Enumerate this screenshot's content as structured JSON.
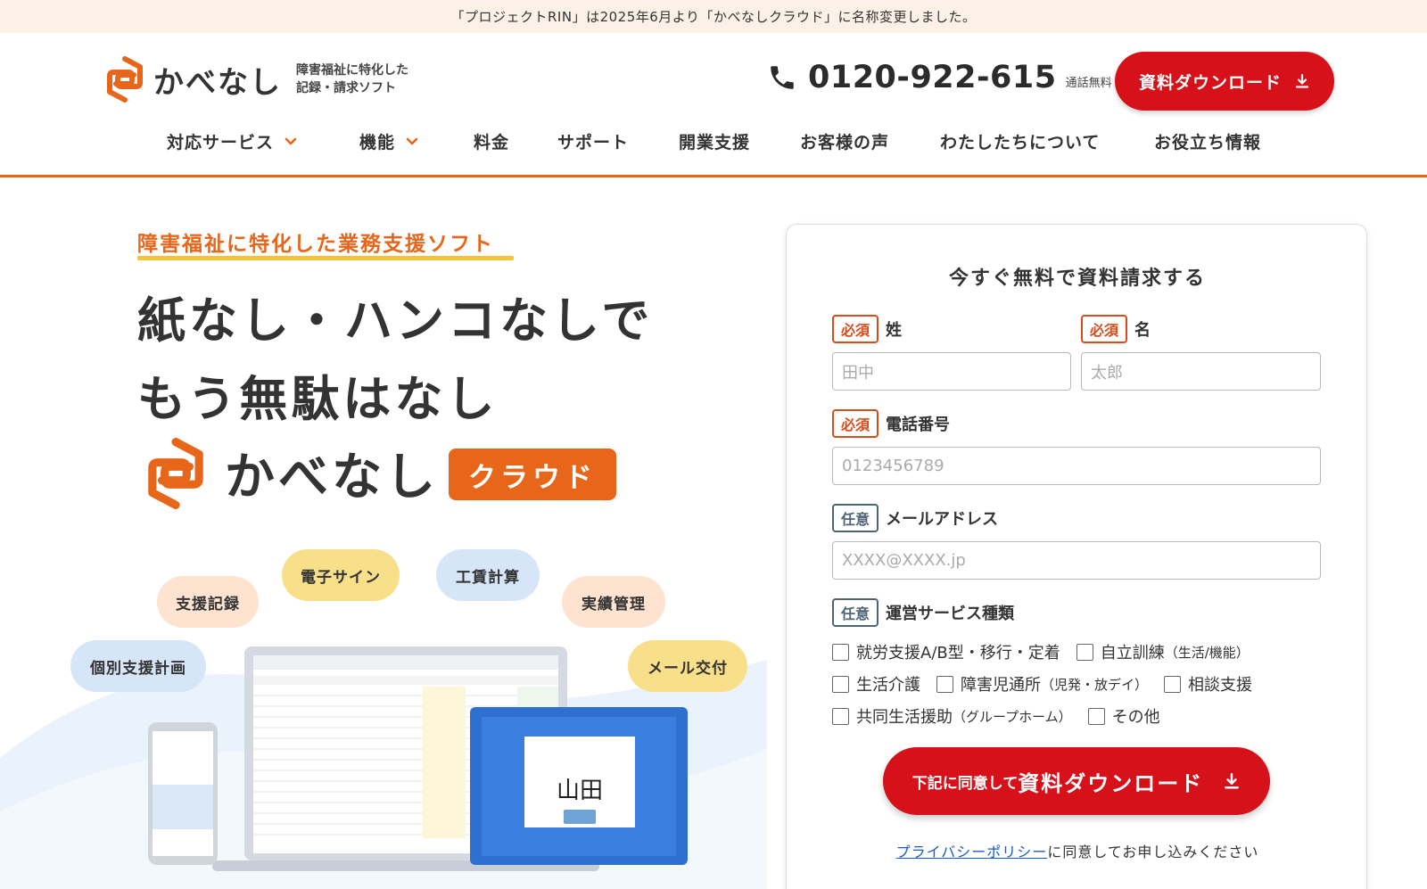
{
  "announcement": "「プロジェクトRIN」は2025年6月より「かべなしクラウド」に名称変更しました。",
  "header": {
    "logo_name": "かべなし",
    "logo_tagline_1": "障害福祉に特化した",
    "logo_tagline_2": "記録・請求ソフト",
    "phone_number": "0120-922-615",
    "phone_note": "通話無料",
    "download_button": "資料ダウンロード"
  },
  "nav": {
    "items": [
      {
        "label": "対応サービス",
        "dropdown": true
      },
      {
        "label": "機能",
        "dropdown": true
      },
      {
        "label": "料金",
        "dropdown": false
      },
      {
        "label": "サポート",
        "dropdown": false
      },
      {
        "label": "開業支援",
        "dropdown": false
      },
      {
        "label": "お客様の声",
        "dropdown": false
      },
      {
        "label": "わたしたちについて",
        "dropdown": false
      },
      {
        "label": "お役立ち情報",
        "dropdown": false
      }
    ]
  },
  "hero": {
    "subtitle": "障害福祉に特化した業務支援ソフト",
    "title_line_1": "紙なし・ハンコなしで",
    "title_line_2": "もう無駄はなし",
    "product_name": "かべなし",
    "product_badge": "クラウド",
    "features": [
      "支援記録",
      "電子サイン",
      "工賃計算",
      "実績管理",
      "個別支援計画",
      "メール交付"
    ],
    "tablet_signature_name": "山田"
  },
  "form": {
    "title": "今すぐ無料で資料請求する",
    "required_tag": "必須",
    "optional_tag": "任意",
    "last_name_label": "姓",
    "last_name_placeholder": "田中",
    "first_name_label": "名",
    "first_name_placeholder": "太郎",
    "phone_label": "電話番号",
    "phone_placeholder": "0123456789",
    "email_label": "メールアドレス",
    "email_placeholder": "XXXX@XXXX.jp",
    "service_label": "運営サービス種類",
    "services": {
      "s1": "就労支援A/B型・移行・定着",
      "s2": "自立訓練",
      "s2_note": "（生活/機能）",
      "s3": "生活介護",
      "s4": "障害児通所",
      "s4_note": "（児発・放デイ）",
      "s5": "相談支援",
      "s6": "共同生活援助",
      "s6_note": "（グループホーム）",
      "s7": "その他"
    },
    "submit_prefix": "下記に同意して",
    "submit_main": "資料ダウンロード",
    "privacy_link": "プライバシーポリシー",
    "privacy_text": "に同意してお申し込みください"
  },
  "colors": {
    "brand_orange": "#e8661a",
    "cta_red": "#d6111a",
    "accent_yellow": "#f6c23c",
    "announce_bg": "#fbf1e6"
  }
}
